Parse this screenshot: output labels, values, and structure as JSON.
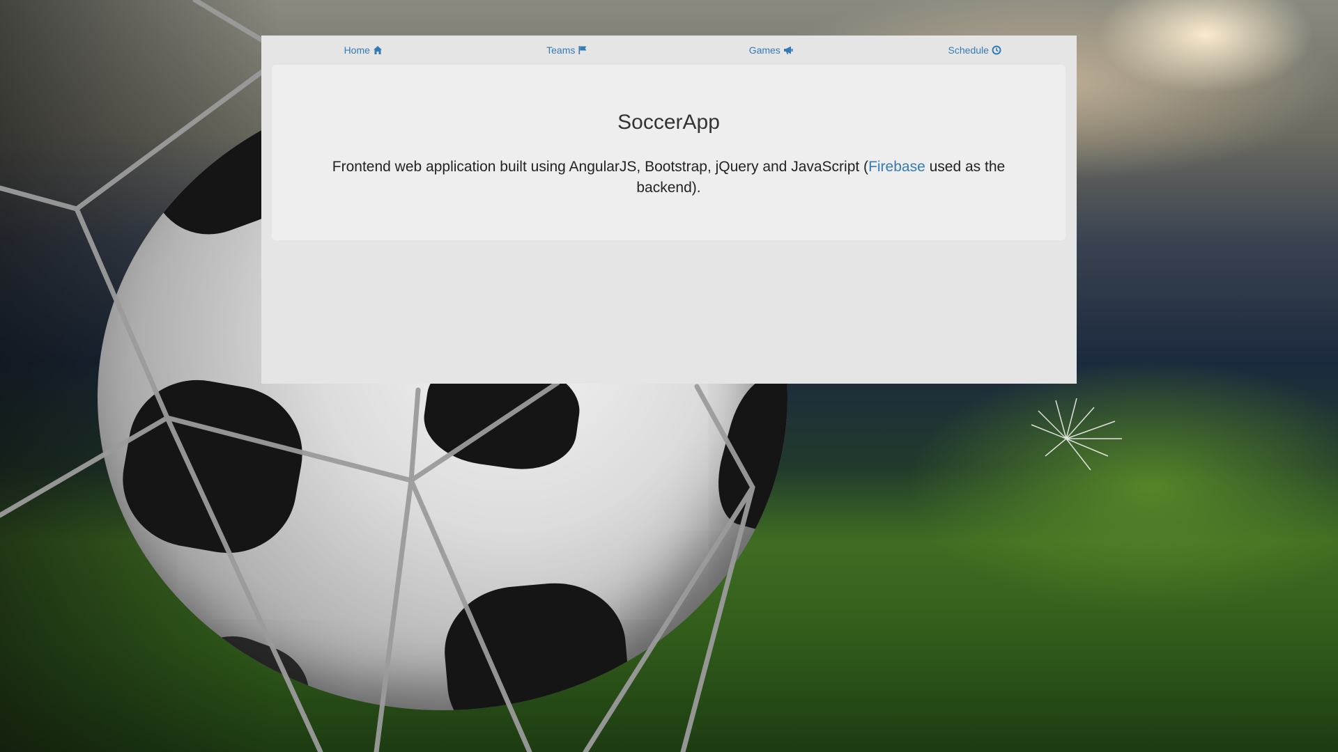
{
  "nav": {
    "items": [
      {
        "label": "Home",
        "icon": "home-icon"
      },
      {
        "label": "Teams",
        "icon": "flag-icon"
      },
      {
        "label": "Games",
        "icon": "bullhorn-icon"
      },
      {
        "label": "Schedule",
        "icon": "clock-icon"
      }
    ]
  },
  "jumbotron": {
    "title": "SoccerApp",
    "description_before": "Frontend web application built using AngularJS, Bootstrap, jQuery and JavaScript (",
    "link_text": "Firebase",
    "description_after": " used as the backend)."
  },
  "colors": {
    "link": "#337ab7",
    "panel_bg": "#e5e5e5",
    "jumbotron_bg": "#eeeeee",
    "title_text": "#333333"
  }
}
